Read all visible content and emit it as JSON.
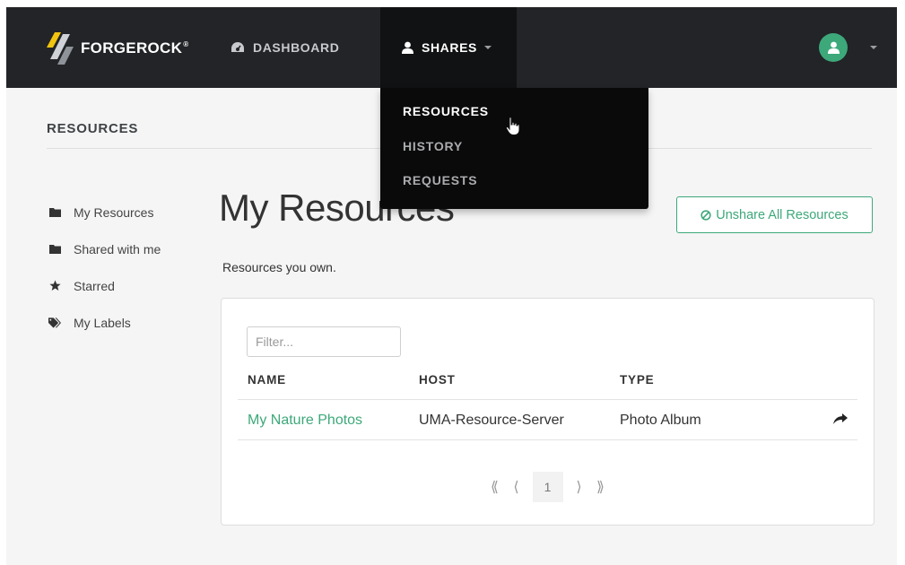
{
  "brand": {
    "name": "FORGEROCK",
    "reg": "®"
  },
  "nav": {
    "dashboard": "DASHBOARD",
    "shares": "SHARES"
  },
  "dropdown": [
    "RESOURCES",
    "HISTORY",
    "REQUESTS"
  ],
  "section_title": "RESOURCES",
  "sidebar": [
    {
      "label": "My Resources",
      "icon": "folder-icon"
    },
    {
      "label": "Shared with me",
      "icon": "folder-icon"
    },
    {
      "label": "Starred",
      "icon": "star-icon"
    },
    {
      "label": "My Labels",
      "icon": "tags-icon"
    }
  ],
  "page": {
    "title": "My Resources",
    "subtitle": "Resources you own.",
    "unshare_label": "Unshare All Resources"
  },
  "filter": {
    "placeholder": "Filter..."
  },
  "table": {
    "headers": [
      "NAME",
      "HOST",
      "TYPE"
    ],
    "rows": [
      {
        "name": "My Nature Photos",
        "host": "UMA-Resource-Server",
        "type": "Photo Album"
      }
    ]
  },
  "pagination": {
    "current_page": "1"
  },
  "colors": {
    "accent": "#3da87a",
    "navbar": "#222427",
    "dropdown": "#0a0a0a"
  }
}
